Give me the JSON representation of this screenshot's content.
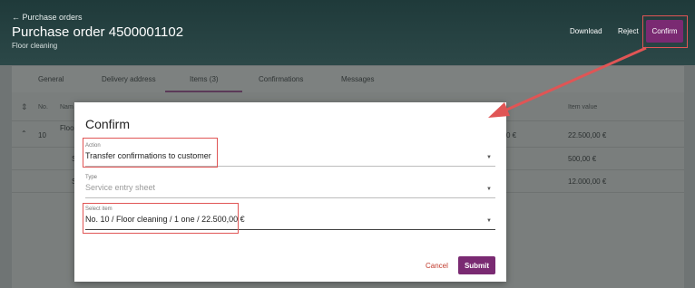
{
  "header": {
    "back_label": "← Purchase orders",
    "title": "Purchase order 4500001102",
    "subtitle": "Floor cleaning",
    "download_label": "Download",
    "reject_label": "Reject",
    "confirm_label": "Confirm"
  },
  "tabs": [
    "General",
    "Delivery address",
    "Items (3)",
    "Confirmations",
    "Messages"
  ],
  "table": {
    "headers": {
      "no": "No.",
      "name": "Nam",
      "item_value": "Item value"
    },
    "rows": [
      {
        "no": "10",
        "name": "Floo",
        "mid": "0 €",
        "value": "22.500,00 €"
      },
      {
        "no": "",
        "name": "S",
        "mid": "",
        "value": "500,00 €"
      },
      {
        "no": "",
        "name": "S",
        "mid": "",
        "value": "12.000,00 €"
      }
    ]
  },
  "modal": {
    "title": "Confirm",
    "action_label": "Action",
    "action_value": "Transfer confirmations to customer",
    "type_label": "Type",
    "type_value": "Service entry sheet",
    "item_label": "Select item",
    "item_value": "No. 10 / Floor cleaning / 1 one / 22.500,00 €",
    "cancel_label": "Cancel",
    "submit_label": "Submit"
  },
  "colors": {
    "accent": "#7a2a72",
    "highlight": "#e05555"
  }
}
